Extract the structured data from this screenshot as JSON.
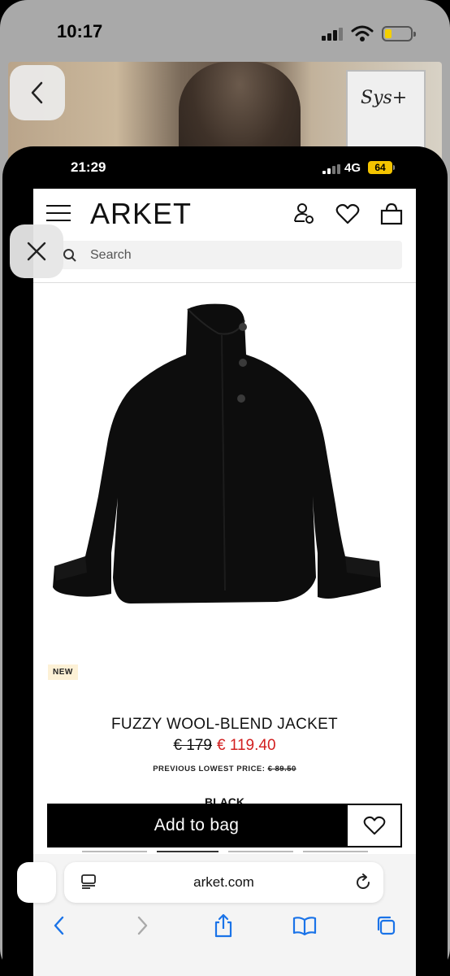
{
  "outer_status": {
    "time": "10:17"
  },
  "photo": {
    "sign_text": "Sys+"
  },
  "inner_status": {
    "time": "21:29",
    "network": "4G",
    "battery": "64"
  },
  "header": {
    "logo": "ARKET"
  },
  "search": {
    "placeholder": "Search"
  },
  "product": {
    "badge": "NEW",
    "title": "FUZZY WOOL-BLEND JACKET",
    "price_old": "€ 179",
    "price_new": "€ 119.40",
    "prev_lowest_label": "PREVIOUS LOWEST PRICE:",
    "prev_lowest_value": "€ 89.50",
    "color": "BLACK"
  },
  "actions": {
    "add_to_bag": "Add to bag"
  },
  "browser": {
    "url": "arket.com"
  },
  "icons": {
    "back": "chevron-left-icon",
    "close": "close-icon",
    "menu": "hamburger-icon",
    "account": "account-settings-icon",
    "wishlist": "heart-icon",
    "bag": "shopping-bag-icon",
    "search": "search-icon",
    "reader": "reader-icon",
    "reload": "reload-icon",
    "share": "share-icon",
    "bookmarks": "book-icon",
    "tabs": "tabs-icon"
  },
  "colors": {
    "sale_price": "#d21f1f",
    "badge_bg": "#fdf1d6",
    "battery": "#f4c400"
  }
}
